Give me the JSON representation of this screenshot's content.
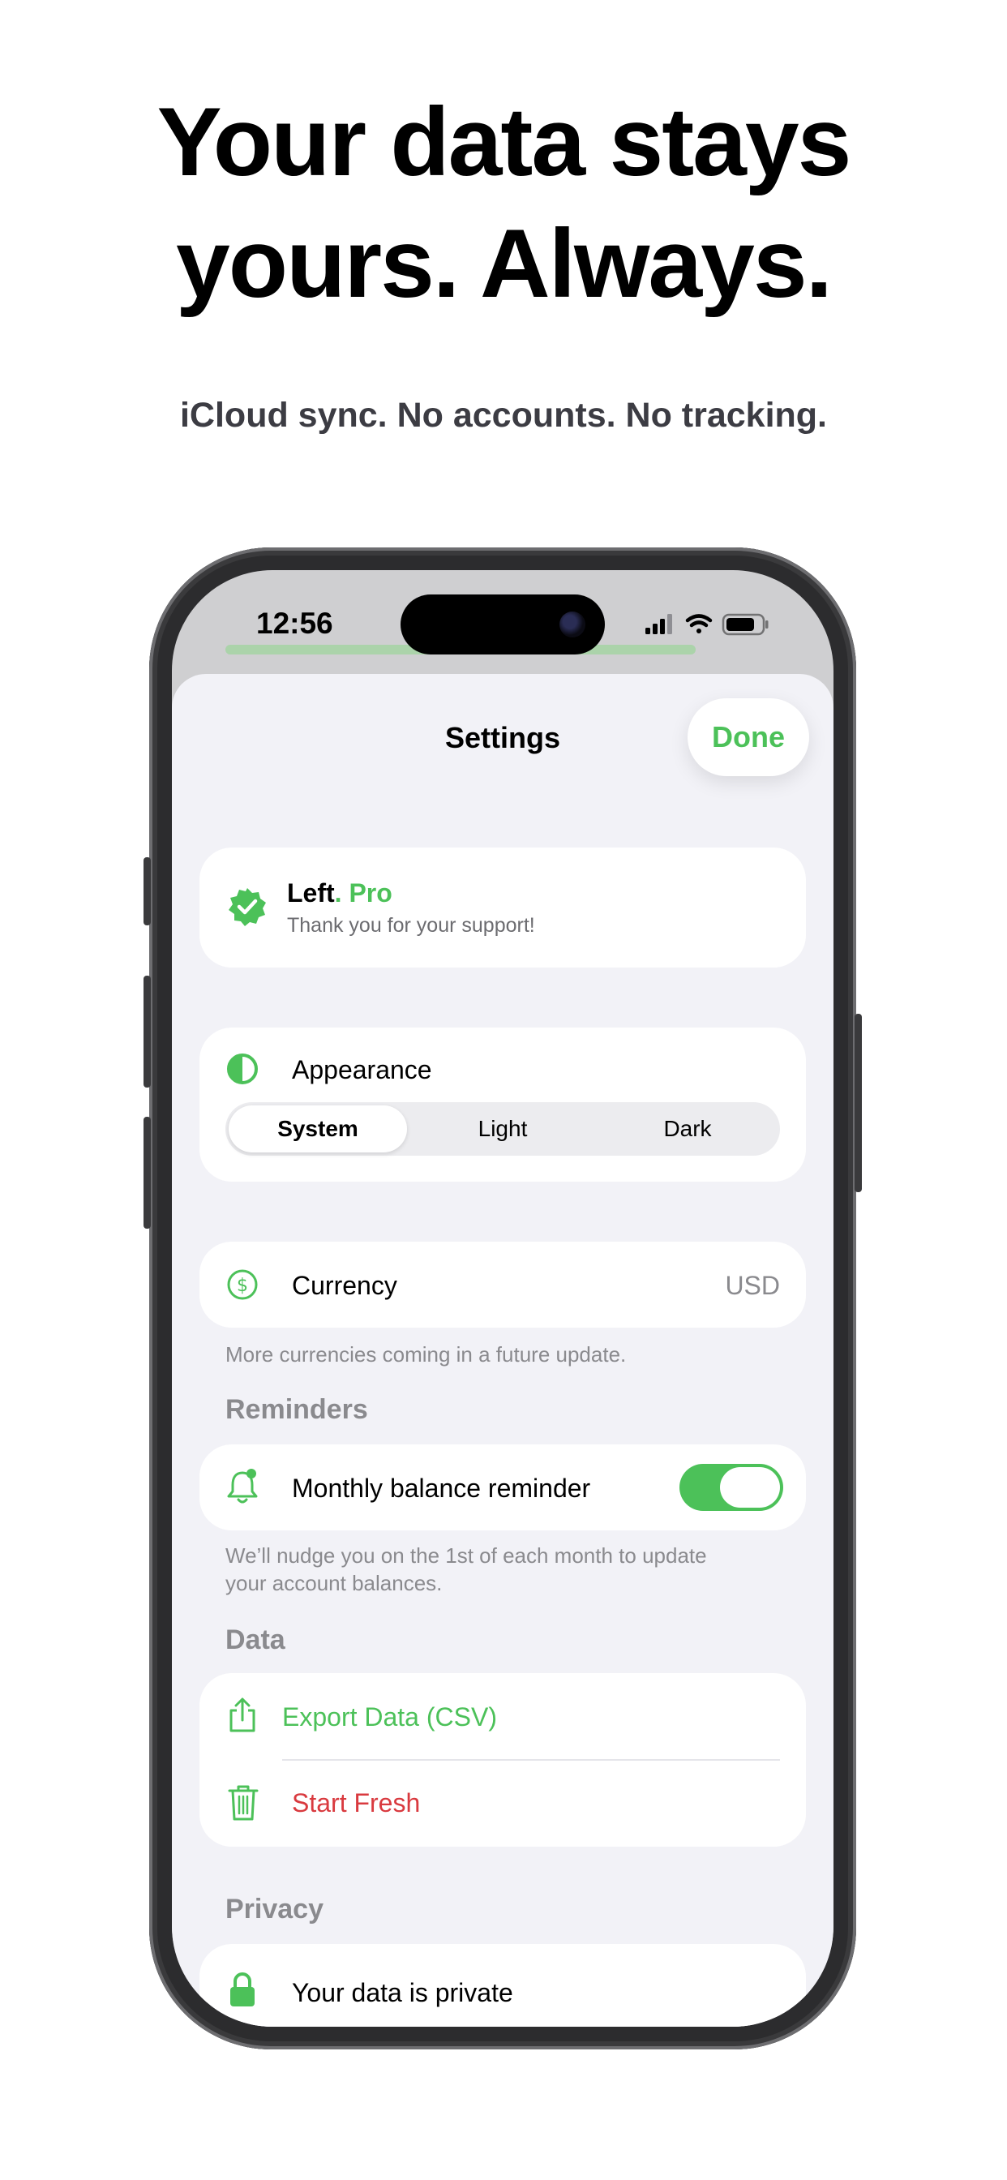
{
  "marketing": {
    "headline_line1": "Your data stays",
    "headline_line2": "yours. Always.",
    "subline": "iCloud sync. No accounts. No tracking."
  },
  "status_bar": {
    "time": "12:56"
  },
  "sheet": {
    "title": "Settings",
    "done_label": "Done"
  },
  "pro": {
    "brand": "Left",
    "dot": ".",
    "tier": "Pro",
    "subtitle": "Thank you for your support!"
  },
  "appearance": {
    "label": "Appearance",
    "options": [
      "System",
      "Light",
      "Dark"
    ],
    "selected": "System"
  },
  "currency": {
    "label": "Currency",
    "value": "USD",
    "footnote": "More currencies coming in a future update."
  },
  "reminders": {
    "header": "Reminders",
    "label": "Monthly balance reminder",
    "enabled": true,
    "footnote_line1": "We’ll nudge you on the 1st of each month to update",
    "footnote_line2": "your account balances."
  },
  "data_section": {
    "header": "Data",
    "export_label": "Export Data (CSV)",
    "reset_label": "Start Fresh"
  },
  "privacy": {
    "header": "Privacy",
    "label": "Your data is private"
  },
  "colors": {
    "accent": "#4cc159",
    "destructive": "#d93a3f",
    "background": "#f2f2f7"
  },
  "icons": {
    "pro": "verified-badge-icon",
    "appearance": "half-circle-icon",
    "currency": "dollar-circle-icon",
    "reminder": "bell-icon",
    "export": "share-icon",
    "reset": "trash-icon",
    "privacy": "lock-icon"
  }
}
